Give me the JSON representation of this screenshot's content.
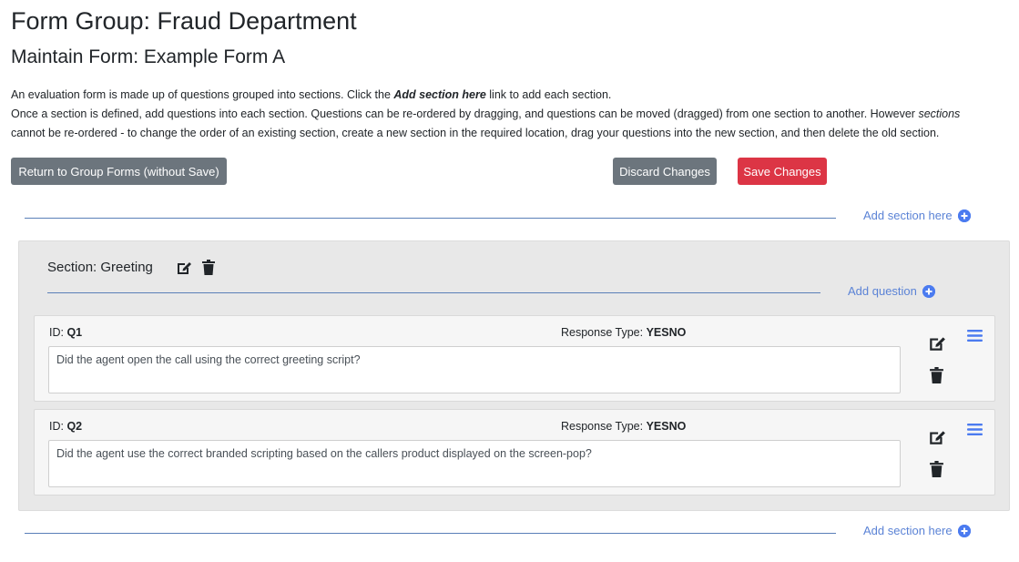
{
  "header": {
    "title": "Form Group: Fraud Department",
    "subtitle": "Maintain Form: Example Form A"
  },
  "intro": {
    "line1_before": "An evaluation form is made up of questions grouped into sections. Click the ",
    "line1_link": "Add section here",
    "line1_after": " link to add each section.",
    "line2_before": "Once a section is defined, add questions into each section. Questions can be re-ordered by dragging, and questions can be moved (dragged) from one section to another. However ",
    "line2_em": "sections",
    "line3": "cannot be re-ordered - to change the order of an existing section, create a new section in the required location, drag your questions into the new section, and then delete the old section."
  },
  "toolbar": {
    "return_label": "Return to Group Forms (without Save)",
    "discard_label": "Discard Changes",
    "save_label": "Save Changes"
  },
  "add_section_label": "Add section here",
  "section": {
    "title": "Section: Greeting",
    "add_question_label": "Add question",
    "questions": [
      {
        "id_label": "ID: ",
        "id": "Q1",
        "type_label": "Response Type: ",
        "type": "YESNO",
        "text": "Did the agent open the call using the correct greeting script?"
      },
      {
        "id_label": "ID: ",
        "id": "Q2",
        "type_label": "Response Type: ",
        "type": "YESNO",
        "text": "Did the agent use the correct branded scripting based on the callers product displayed on the screen-pop?"
      }
    ]
  },
  "colors": {
    "primary_grey": "#6c757d",
    "danger_red": "#dc3545",
    "link_blue": "#5b83d6",
    "section_bg": "#e8e8e8"
  },
  "icons": {
    "edit": "edit-icon",
    "delete": "trash-icon",
    "drag": "drag-handle-icon",
    "add": "plus-circle-icon"
  }
}
